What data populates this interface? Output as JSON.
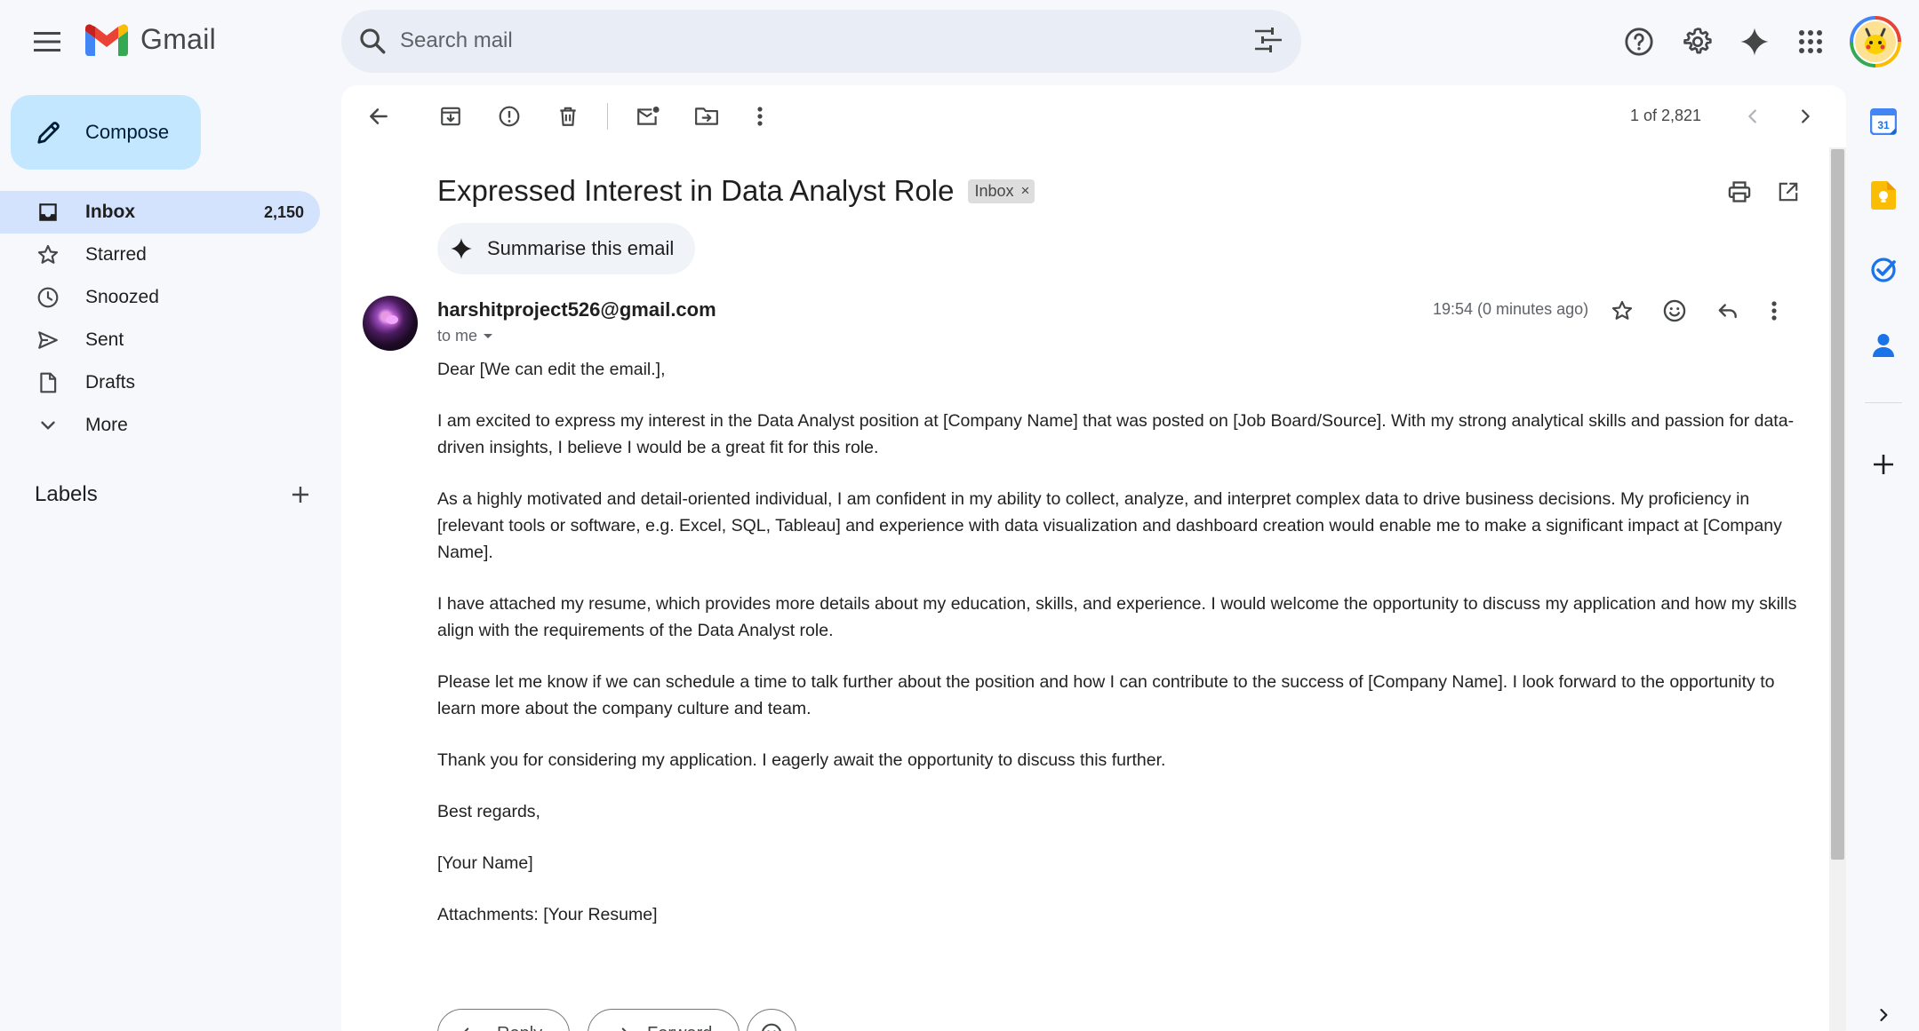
{
  "app": {
    "name": "Gmail"
  },
  "search": {
    "placeholder": "Search mail"
  },
  "compose": {
    "label": "Compose"
  },
  "nav": {
    "items": [
      {
        "label": "Inbox",
        "count": "2,150",
        "icon": "inbox-icon",
        "active": true
      },
      {
        "label": "Starred",
        "icon": "star-icon"
      },
      {
        "label": "Snoozed",
        "icon": "clock-icon"
      },
      {
        "label": "Sent",
        "icon": "send-icon"
      },
      {
        "label": "Drafts",
        "icon": "draft-icon"
      },
      {
        "label": "More",
        "icon": "chevron-down-icon"
      }
    ]
  },
  "labels": {
    "title": "Labels"
  },
  "toolbar": {
    "pager": "1 of 2,821"
  },
  "email": {
    "subject": "Expressed Interest in Data Analyst Role",
    "chip": "Inbox",
    "chip_close": "×",
    "summarise": "Summarise this email",
    "sender": "harshitproject526@gmail.com",
    "to": "to me",
    "time": "19:54 (0 minutes ago)",
    "body": [
      "Dear [We can edit the email.],",
      "I am excited to express my interest in the Data Analyst position at [Company Name] that was posted on [Job Board/Source]. With my strong analytical skills and passion for data-driven insights, I believe I would be a great fit for this role.",
      "As a highly motivated and detail-oriented individual, I am confident in my ability to collect, analyze, and interpret complex data to drive business decisions. My proficiency in [relevant tools or software, e.g. Excel, SQL, Tableau] and experience with data visualization and dashboard creation would enable me to make a significant impact at [Company Name].",
      "I have attached my resume, which provides more details about my education, skills, and experience. I would welcome the opportunity to discuss my application and how my skills align with the requirements of the Data Analyst role.",
      "Please let me know if we can schedule a time to talk further about the position and how I can contribute to the success of [Company Name]. I look forward to the opportunity to learn more about the company culture and team.",
      "Thank you for considering my application. I eagerly await the opportunity to discuss this further.",
      "Best regards,",
      "[Your Name]",
      "Attachments: [Your Resume]"
    ],
    "reply_label": "Reply",
    "forward_label": "Forward"
  },
  "colors": {
    "background": "#f6f8fc",
    "compose": "#c2e7ff",
    "active_nav": "#d3e3fd",
    "search": "#e9eef6"
  }
}
